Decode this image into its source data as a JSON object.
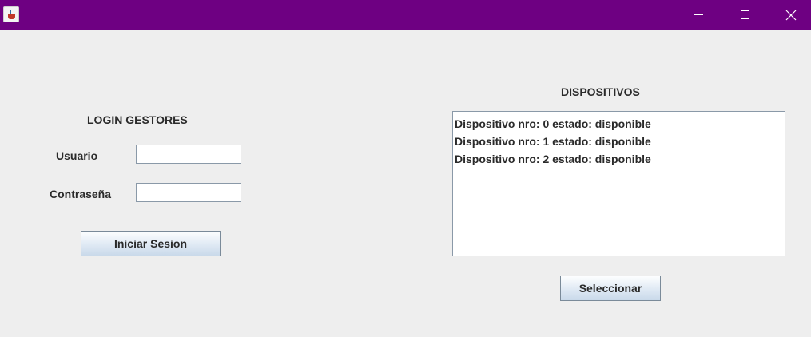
{
  "window": {
    "icon": "java-cup-icon",
    "titlebar_color": "#6e0082",
    "controls": [
      "minimize-icon",
      "maximize-icon",
      "close-icon"
    ]
  },
  "login": {
    "heading": "LOGIN GESTORES",
    "user_label": "Usuario",
    "user_value": "",
    "password_label": "Contraseña",
    "password_value": "",
    "submit_label": "Iniciar Sesion"
  },
  "devices": {
    "heading": "DISPOSITIVOS",
    "items": [
      "Dispositivo nro: 0 estado: disponible",
      "Dispositivo nro: 1 estado: disponible",
      "Dispositivo nro: 2 estado: disponible"
    ],
    "select_label": "Seleccionar"
  }
}
